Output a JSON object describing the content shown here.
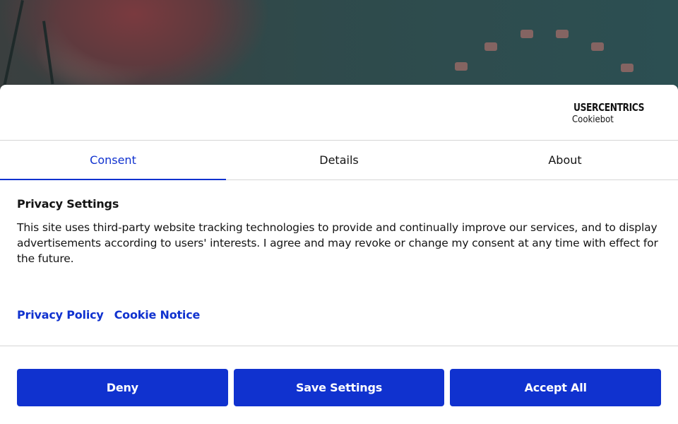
{
  "brand": {
    "name": "USERCENTRICS",
    "sub": "Cookiebot",
    "icon": "shield-icon"
  },
  "tabs": [
    {
      "label": "Consent",
      "active": true
    },
    {
      "label": "Details",
      "active": false
    },
    {
      "label": "About",
      "active": false
    }
  ],
  "content": {
    "heading": "Privacy Settings",
    "text": "This site uses third-party website tracking technologies to provide and continually improve our services, and to display advertisements according to users' interests. I agree and may revoke or change my consent at any time with effect for the future."
  },
  "links": {
    "privacy_policy": "Privacy Policy",
    "cookie_notice": "Cookie Notice"
  },
  "buttons": {
    "deny": "Deny",
    "save_settings": "Save Settings",
    "accept_all": "Accept All"
  },
  "colors": {
    "accent": "#1032cf",
    "text": "#141414",
    "divider": "#d6d6d6"
  }
}
